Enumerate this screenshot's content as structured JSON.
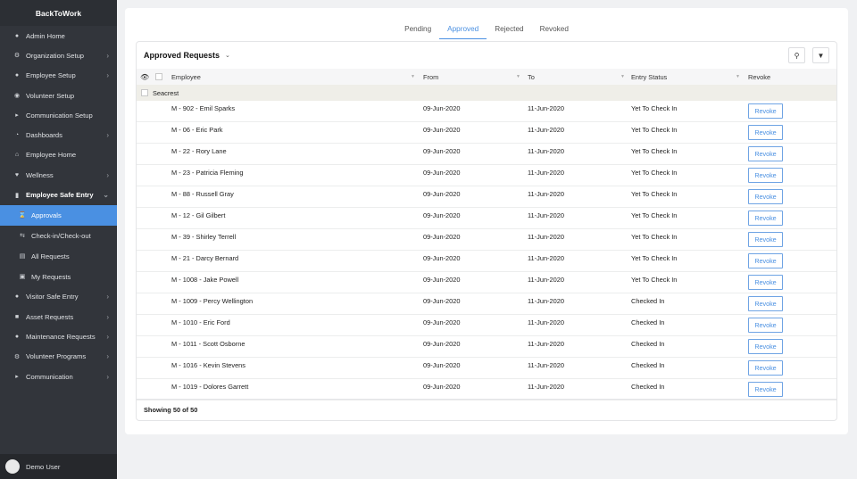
{
  "app": {
    "title": "BackToWork",
    "user": "Demo User"
  },
  "sidebar": {
    "items": [
      {
        "label": "Admin Home",
        "icon": "user-icon",
        "chev": false
      },
      {
        "label": "Organization Setup",
        "icon": "gear-icon",
        "chev": true
      },
      {
        "label": "Employee Setup",
        "icon": "users-icon",
        "chev": true
      },
      {
        "label": "Volunteer Setup",
        "icon": "award-icon",
        "chev": false
      },
      {
        "label": "Communication Setup",
        "icon": "megaphone-icon",
        "chev": false
      },
      {
        "label": "Dashboards",
        "icon": "pie-chart-icon",
        "chev": true
      },
      {
        "label": "Employee Home",
        "icon": "home-icon",
        "chev": false
      },
      {
        "label": "Wellness",
        "icon": "heart-icon",
        "chev": true
      },
      {
        "label": "Employee Safe Entry",
        "icon": "door-icon",
        "chev": true
      }
    ],
    "subitems": [
      {
        "label": "Approvals",
        "icon": "hourglass-icon"
      },
      {
        "label": "Check-in/Check-out",
        "icon": "swap-icon"
      },
      {
        "label": "All Requests",
        "icon": "list-icon"
      },
      {
        "label": "My Requests",
        "icon": "clipboard-icon"
      }
    ],
    "items2": [
      {
        "label": "Visitor Safe Entry",
        "icon": "user-icon"
      },
      {
        "label": "Asset Requests",
        "icon": "box-icon"
      },
      {
        "label": "Maintenance Requests",
        "icon": "wrench-icon"
      },
      {
        "label": "Volunteer Programs",
        "icon": "gear-icon"
      },
      {
        "label": "Communication",
        "icon": "megaphone-icon"
      }
    ]
  },
  "tabs": [
    "Pending",
    "Approved",
    "Rejected",
    "Revoked"
  ],
  "panel": {
    "title": "Approved Requests",
    "footer": "Showing 50 of 50"
  },
  "columns": [
    "Employee",
    "From",
    "To",
    "Entry Status",
    "Revoke"
  ],
  "group": "Seacrest",
  "revoke_label": "Revoke",
  "rows": [
    [
      "M - 902 - Emil Sparks",
      "09-Jun-2020",
      "11-Jun-2020",
      "Yet To Check In"
    ],
    [
      "M - 06 - Eric Park",
      "09-Jun-2020",
      "11-Jun-2020",
      "Yet To Check In"
    ],
    [
      "M - 22 - Rory Lane",
      "09-Jun-2020",
      "11-Jun-2020",
      "Yet To Check In"
    ],
    [
      "M - 23 - Patricia Fleming",
      "09-Jun-2020",
      "11-Jun-2020",
      "Yet To Check In"
    ],
    [
      "M - 88 - Russell Gray",
      "09-Jun-2020",
      "11-Jun-2020",
      "Yet To Check In"
    ],
    [
      "M - 12 - Gil Gilbert",
      "09-Jun-2020",
      "11-Jun-2020",
      "Yet To Check In"
    ],
    [
      "M - 39 - Shirley Terrell",
      "09-Jun-2020",
      "11-Jun-2020",
      "Yet To Check In"
    ],
    [
      "M - 21 - Darcy Bernard",
      "09-Jun-2020",
      "11-Jun-2020",
      "Yet To Check In"
    ],
    [
      "M - 1008 - Jake Powell",
      "09-Jun-2020",
      "11-Jun-2020",
      "Yet To Check In"
    ],
    [
      "M - 1009 - Percy Wellington",
      "09-Jun-2020",
      "11-Jun-2020",
      "Checked In"
    ],
    [
      "M - 1010 - Eric Ford",
      "09-Jun-2020",
      "11-Jun-2020",
      "Checked In"
    ],
    [
      "M - 1011 - Scott Osborne",
      "09-Jun-2020",
      "11-Jun-2020",
      "Checked In"
    ],
    [
      "M - 1016 - Kevin Stevens",
      "09-Jun-2020",
      "11-Jun-2020",
      "Checked In"
    ],
    [
      "M - 1019 - Dolores Garrett",
      "09-Jun-2020",
      "11-Jun-2020",
      "Checked In"
    ]
  ]
}
